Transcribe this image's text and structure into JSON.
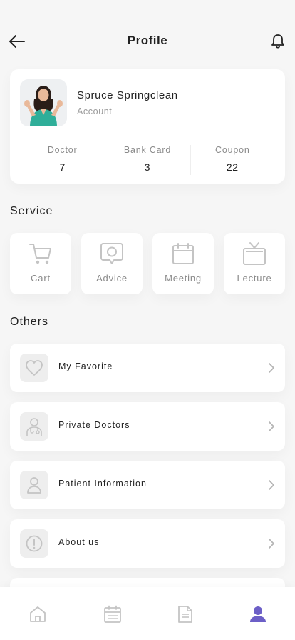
{
  "header": {
    "title": "Profile",
    "back_icon": "arrow-left-icon",
    "bell_icon": "bell-icon"
  },
  "profile": {
    "name": "Spruce Springclean",
    "subtitle": "Account",
    "avatar_icon": "avatar-photo",
    "stats": [
      {
        "label": "Doctor",
        "value": "7"
      },
      {
        "label": "Bank Card",
        "value": "3"
      },
      {
        "label": "Coupon",
        "value": "22"
      }
    ]
  },
  "service": {
    "title": "Service",
    "items": [
      {
        "label": "Cart",
        "icon": "cart-icon"
      },
      {
        "label": "Advice",
        "icon": "chat-bubble-icon"
      },
      {
        "label": "Meeting",
        "icon": "calendar-icon"
      },
      {
        "label": "Lecture",
        "icon": "tv-icon"
      }
    ]
  },
  "others": {
    "title": "Others",
    "items": [
      {
        "label": "My Favorite",
        "icon": "heart-icon"
      },
      {
        "label": "Private Doctors",
        "icon": "doctor-icon"
      },
      {
        "label": "Patient Information",
        "icon": "person-icon"
      },
      {
        "label": "About us",
        "icon": "info-icon"
      }
    ]
  },
  "bottom_nav": {
    "items": [
      {
        "icon": "home-icon",
        "active": false
      },
      {
        "icon": "calendar-icon",
        "active": false
      },
      {
        "icon": "document-icon",
        "active": false
      },
      {
        "icon": "profile-icon",
        "active": true
      }
    ]
  },
  "colors": {
    "background": "#f6f6f6",
    "card": "#ffffff",
    "muted_text": "#8a8a8a",
    "icon_gray": "#c4c4c4",
    "accent": "#6c5fc7"
  }
}
